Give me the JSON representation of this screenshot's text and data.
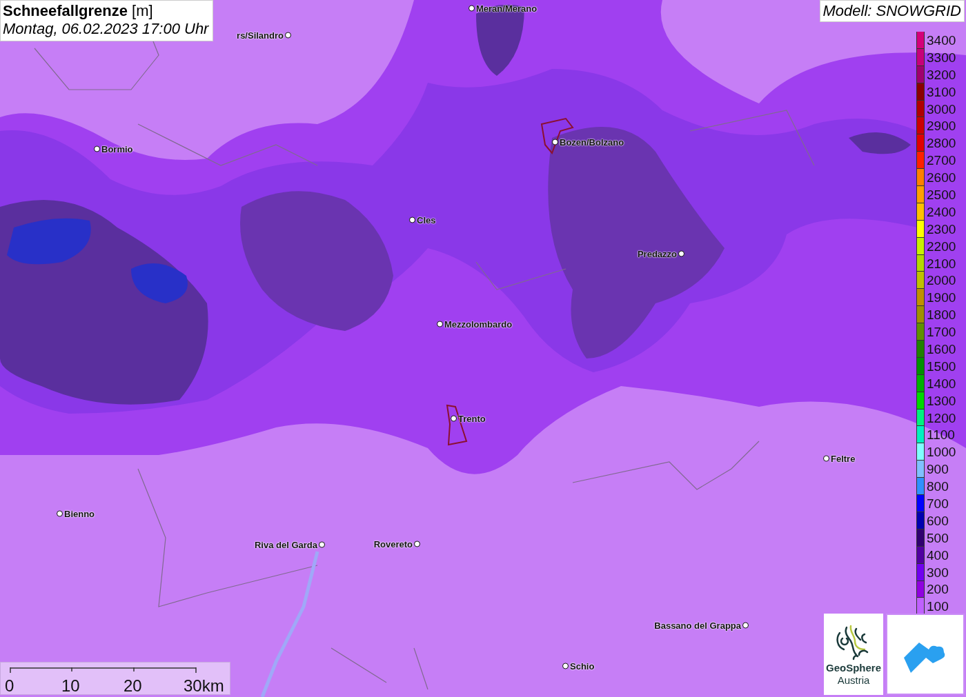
{
  "title": {
    "name": "Schneefallgrenze",
    "unit": "[m]",
    "time": "Montag, 06.02.2023 17:00 Uhr"
  },
  "model": "Modell: SNOWGRID",
  "places": [
    {
      "name": "Meran/Merano"
    },
    {
      "name": "rs/Silandro"
    },
    {
      "name": "Bormio"
    },
    {
      "name": "Bozen/Bolzano"
    },
    {
      "name": "Cles"
    },
    {
      "name": "Predazzo"
    },
    {
      "name": "Mezzolombardo"
    },
    {
      "name": "Trento"
    },
    {
      "name": "Feltre"
    },
    {
      "name": "Bienno"
    },
    {
      "name": "Riva del Garda"
    },
    {
      "name": "Rovereto"
    },
    {
      "name": "Bassano del Grappa"
    },
    {
      "name": "Schio"
    }
  ],
  "legend": [
    {
      "label": "3400",
      "color": "#d4007a"
    },
    {
      "label": "3300",
      "color": "#c8007a"
    },
    {
      "label": "3200",
      "color": "#a0006e"
    },
    {
      "label": "3100",
      "color": "#8b0000"
    },
    {
      "label": "3000",
      "color": "#b00000"
    },
    {
      "label": "2900",
      "color": "#cc0000"
    },
    {
      "label": "2800",
      "color": "#e00000"
    },
    {
      "label": "2700",
      "color": "#ff2000"
    },
    {
      "label": "2600",
      "color": "#ff8000"
    },
    {
      "label": "2500",
      "color": "#ffa000"
    },
    {
      "label": "2400",
      "color": "#ffc000"
    },
    {
      "label": "2300",
      "color": "#ffff00"
    },
    {
      "label": "2200",
      "color": "#c8f000"
    },
    {
      "label": "2100",
      "color": "#b4d800"
    },
    {
      "label": "2000",
      "color": "#c0c000"
    },
    {
      "label": "1900",
      "color": "#c09000"
    },
    {
      "label": "1800",
      "color": "#a09000"
    },
    {
      "label": "1700",
      "color": "#609000"
    },
    {
      "label": "1600",
      "color": "#208000"
    },
    {
      "label": "1500",
      "color": "#009000"
    },
    {
      "label": "1400",
      "color": "#00b000"
    },
    {
      "label": "1300",
      "color": "#00d800"
    },
    {
      "label": "1200",
      "color": "#00f080"
    },
    {
      "label": "1100",
      "color": "#00f0c0"
    },
    {
      "label": "1000",
      "color": "#80ffff"
    },
    {
      "label": "900",
      "color": "#80c0ff"
    },
    {
      "label": "800",
      "color": "#3090ff"
    },
    {
      "label": "700",
      "color": "#0000ff"
    },
    {
      "label": "600",
      "color": "#0000b0"
    },
    {
      "label": "500",
      "color": "#300070"
    },
    {
      "label": "400",
      "color": "#5000a0"
    },
    {
      "label": "300",
      "color": "#7000f0"
    },
    {
      "label": "200",
      "color": "#9000e0"
    },
    {
      "label": "100",
      "color": "#c060ff"
    }
  ],
  "scale_bar": {
    "ticks": [
      "0",
      "10",
      "20",
      "30km"
    ]
  },
  "logos": [
    {
      "kind": "geosphere",
      "lines": [
        "GeoSphere",
        "Austria"
      ]
    },
    {
      "kind": "cloud"
    }
  ]
}
